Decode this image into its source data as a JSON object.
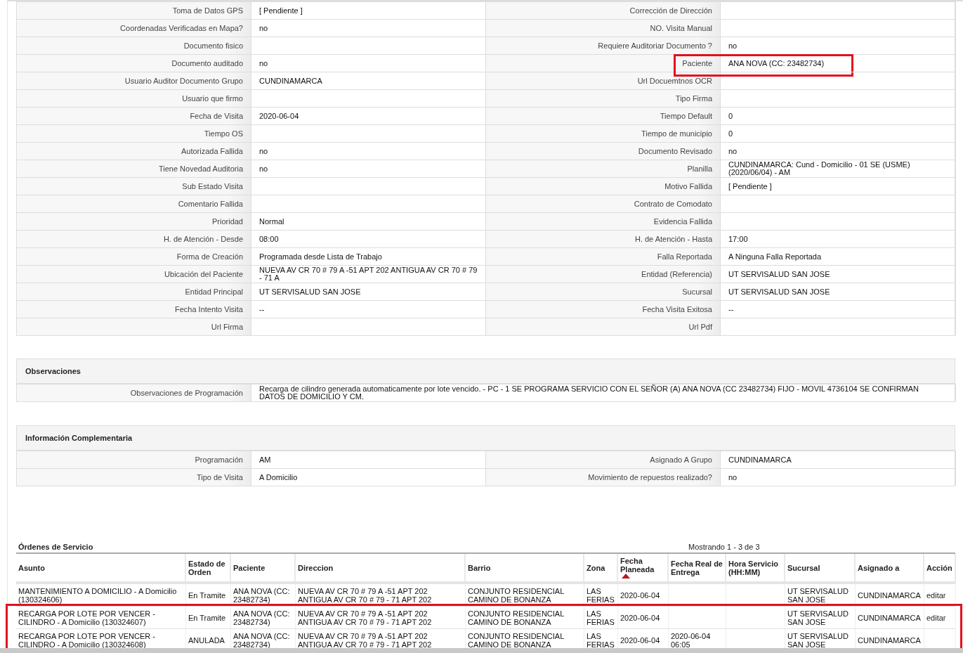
{
  "details": [
    [
      {
        "label": "Toma de Datos GPS",
        "value": "[ Pendiente ]",
        "highlighted": false
      },
      {
        "label": "Corrección de Dirección",
        "highlighted": false
      }
    ],
    [
      {
        "label": "Coordenadas Verificadas en Mapa?",
        "value": "no",
        "highlighted": false
      },
      {
        "label": "NO. Visita Manual",
        "highlighted": false
      }
    ],
    [
      {
        "label": "Documento fisico",
        "highlighted": false
      },
      {
        "label": "Requiere Auditoriar Documento ?",
        "value": "no",
        "highlighted": false
      }
    ],
    [
      {
        "label": "Documento auditado",
        "value": "no",
        "highlighted": false
      },
      {
        "label": "Paciente",
        "value": "ANA NOVA (CC: 23482734)",
        "highlighted": true
      }
    ],
    [
      {
        "label": "Usuario Auditor Documento Grupo",
        "value": "CUNDINAMARCA",
        "highlighted": false
      },
      {
        "label": "Url Docuemtnos OCR",
        "highlighted": false
      }
    ],
    [
      {
        "label": "Usuario que firmo",
        "highlighted": false
      },
      {
        "label": "Tipo Firma",
        "highlighted": false
      }
    ],
    [
      {
        "label": "Fecha de Visita",
        "value": "2020-06-04",
        "highlighted": false
      },
      {
        "label": "Tiempo Default",
        "value": "0",
        "highlighted": false
      }
    ],
    [
      {
        "label": "Tiempo OS",
        "highlighted": false
      },
      {
        "label": "Tiempo de municipio",
        "value": "0",
        "highlighted": false
      }
    ],
    [
      {
        "label": "Autorizada Fallida",
        "value": "no",
        "highlighted": false
      },
      {
        "label": "Documento Revisado",
        "value": "no",
        "highlighted": false
      }
    ],
    [
      {
        "label": "Tiene Novedad Auditoria",
        "value": "no",
        "highlighted": false
      },
      {
        "label": "Planilla",
        "value": "CUNDINAMARCA: Cund - Domicilio - 01 SE (USME) (2020/06/04) - AM",
        "highlighted": false
      }
    ],
    [
      {
        "label": "Sub Estado Visita",
        "highlighted": false
      },
      {
        "label": "Motivo Fallida",
        "value": "[ Pendiente ]",
        "highlighted": false
      }
    ],
    [
      {
        "label": "Comentario Fallida",
        "highlighted": false
      },
      {
        "label": "Contrato de Comodato",
        "highlighted": false
      }
    ],
    [
      {
        "label": "Prioridad",
        "value": "Normal",
        "highlighted": false
      },
      {
        "label": "Evidencia Fallida",
        "highlighted": false
      }
    ],
    [
      {
        "label": "H. de Atención - Desde",
        "value": "08:00",
        "highlighted": false
      },
      {
        "label": "H. de Atención - Hasta",
        "value": "17:00",
        "highlighted": false
      }
    ],
    [
      {
        "label": "Forma de Creación",
        "value": "Programada desde Lista de Trabajo",
        "highlighted": false
      },
      {
        "label": "Falla Reportada",
        "value": "A Ninguna Falla Reportada",
        "highlighted": false
      }
    ],
    [
      {
        "label": "Ubicación del Paciente",
        "value": "NUEVA AV CR 70 # 79 A -51 APT 202 ANTIGUA AV CR 70 # 79 - 71 A",
        "highlighted": false
      },
      {
        "label": "Entidad (Referencia)",
        "value": "UT SERVISALUD SAN JOSE",
        "highlighted": false
      }
    ],
    [
      {
        "label": "Entidad Principal",
        "value": "UT SERVISALUD SAN JOSE",
        "highlighted": false
      },
      {
        "label": "Sucursal",
        "value": "UT SERVISALUD SAN JOSE",
        "highlighted": false
      }
    ],
    [
      {
        "label": "Fecha Intento Visita",
        "value": "--",
        "highlighted": false
      },
      {
        "label": "Fecha Visita Exitosa",
        "value": "--",
        "highlighted": false
      }
    ],
    [
      {
        "label": "Url Firma",
        "highlighted": false
      },
      {
        "label": "Url Pdf",
        "highlighted": false
      }
    ]
  ],
  "observaciones": {
    "title": "Observaciones",
    "rows": [
      [
        {
          "label": "Observaciones de Programación",
          "value": "Recarga de cilindro generada automaticamente por lote vencido. - PC - 1 SE PROGRAMA SERVICIO CON EL SEÑOR (A) ANA NOVA (CC 23482734) FIJO - MOVIL 4736104 SE CONFIRMAN DATOS DE DOMICILIO Y CM."
        }
      ]
    ]
  },
  "complementaria": {
    "title": "Información Complementaria",
    "rows": [
      [
        {
          "label": "Programación",
          "value": "AM"
        },
        {
          "label": "Asignado A Grupo",
          "value": "CUNDINAMARCA"
        }
      ],
      [
        {
          "label": "Tipo de Visita",
          "value": "A Domicilio"
        },
        {
          "label": "Movimiento de repuestos realizado?",
          "value": "no"
        }
      ]
    ]
  },
  "ordenes": {
    "title": "Órdenes de Servicio",
    "paging": "Mostrando 1 - 3 de 3",
    "columns": [
      {
        "label": "Asunto",
        "sorted": false
      },
      {
        "label": "Estado de Orden",
        "sorted": false
      },
      {
        "label": "Paciente",
        "sorted": false
      },
      {
        "label": "Direccion",
        "sorted": false
      },
      {
        "label": "Barrio",
        "sorted": false
      },
      {
        "label": "Zona",
        "sorted": false
      },
      {
        "label": "Fecha Planeada",
        "sorted": true
      },
      {
        "label": "Fecha Real de Entrega",
        "sorted": false
      },
      {
        "label": "Hora Servicio (HH:MM)",
        "sorted": false
      },
      {
        "label": "Sucursal",
        "sorted": false
      },
      {
        "label": "Asignado a",
        "sorted": false
      },
      {
        "label": "Acción",
        "sorted": false
      }
    ],
    "rows": [
      {
        "highlighted": false,
        "cells": [
          "MANTENIMIENTO A DOMICILIO - A Domicilio (130324606)",
          "En Tramite",
          "ANA NOVA (CC: 23482734)",
          "NUEVA AV CR 70 # 79 A -51 APT 202 ANTIGUA AV CR 70 # 79 - 71 APT 202",
          "CONJUNTO RESIDENCIAL CAMINO DE BONANZA",
          "LAS FERIAS",
          "2020-06-04",
          null,
          null,
          "UT SERVISALUD SAN JOSE",
          "CUNDINAMARCA",
          "editar"
        ]
      },
      {
        "highlighted": true,
        "cells": [
          "RECARGA POR LOTE POR VENCER - CILINDRO - A Domicilio (130324607)",
          "En Tramite",
          "ANA NOVA (CC: 23482734)",
          "NUEVA AV CR 70 # 79 A -51 APT 202 ANTIGUA AV CR 70 # 79 - 71 APT 202",
          "CONJUNTO RESIDENCIAL CAMINO DE BONANZA",
          "LAS FERIAS",
          "2020-06-04",
          null,
          null,
          "UT SERVISALUD SAN JOSE",
          "CUNDINAMARCA",
          "editar"
        ]
      },
      {
        "highlighted": true,
        "cells": [
          "RECARGA POR LOTE POR VENCER - CILINDRO - A Domicilio (130324608)",
          "ANULADA",
          "ANA NOVA (CC: 23482734)",
          "NUEVA AV CR 70 # 79 A -51 APT 202 ANTIGUA AV CR 70 # 79 - 71 APT 202",
          "CONJUNTO RESIDENCIAL CAMINO DE BONANZA",
          "LAS FERIAS",
          "2020-06-04",
          "2020-06-04 06:05",
          null,
          "UT SERVISALUD SAN JOSE",
          "CUNDINAMARCA",
          null
        ]
      }
    ]
  }
}
